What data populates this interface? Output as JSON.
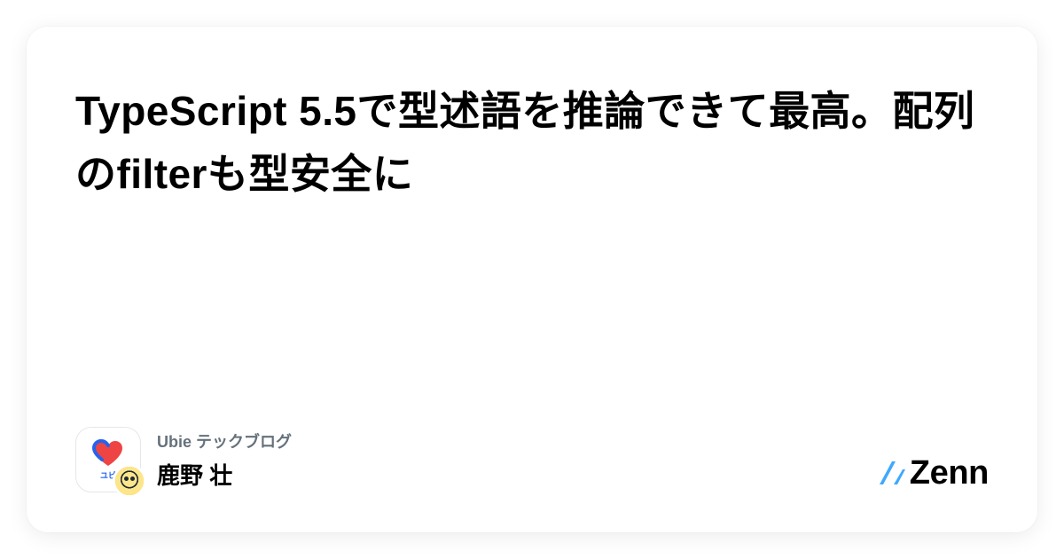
{
  "title": "TypeScript 5.5で型述語を推論できて最高。配列のfilterも型安全に",
  "publication": {
    "name": "Ubie テックブログ",
    "org_label": "ユビ"
  },
  "author": {
    "name": "鹿野 壮"
  },
  "platform": {
    "name": "Zenn"
  }
}
